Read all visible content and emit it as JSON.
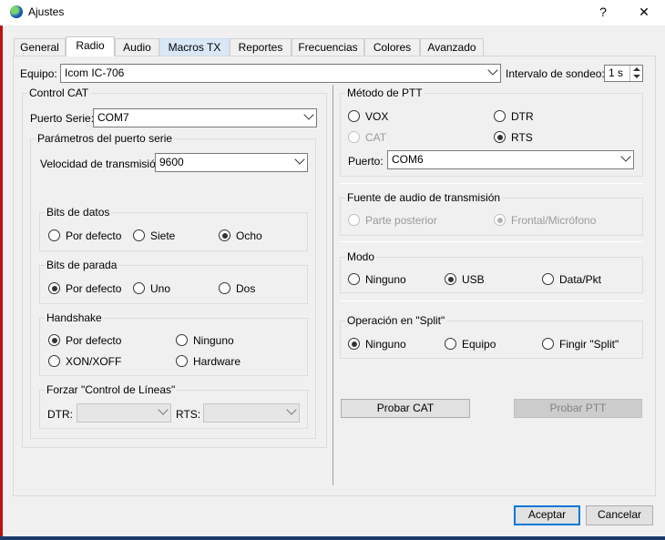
{
  "window": {
    "title": "Ajustes",
    "help_label": "?",
    "close_label": "✕"
  },
  "tabs": [
    {
      "label": "General"
    },
    {
      "label": "Radio"
    },
    {
      "label": "Audio"
    },
    {
      "label": "Macros  TX"
    },
    {
      "label": "Reportes"
    },
    {
      "label": "Frecuencias"
    },
    {
      "label": "Colores"
    },
    {
      "label": "Avanzado"
    }
  ],
  "active_tab": "Radio",
  "rig": {
    "label": "Equipo:",
    "value": "Icom IC-706",
    "poll_label": "Intervalo de sondeo:",
    "poll_value": "1 s"
  },
  "cat": {
    "title": "Control CAT",
    "port_label": "Puerto Serie:",
    "port_value": "COM7",
    "params_title": "Parámetros del puerto serie",
    "baud_label": "Velocidad de transmisión:",
    "baud_value": "9600",
    "data_bits": {
      "title": "Bits de datos",
      "options": [
        "Por defecto",
        "Siete",
        "Ocho"
      ],
      "selected": "Ocho"
    },
    "stop_bits": {
      "title": "Bits de parada",
      "options": [
        "Por defecto",
        "Uno",
        "Dos"
      ],
      "selected": "Por defecto"
    },
    "handshake": {
      "title": "Handshake",
      "options": [
        "Por defecto",
        "Ninguno",
        "XON/XOFF",
        "Hardware"
      ],
      "selected": "Por defecto"
    },
    "force_lines": {
      "title": "Forzar \"Control de Líneas\"",
      "dtr_label": "DTR:",
      "dtr_value": "",
      "rts_label": "RTS:",
      "rts_value": ""
    }
  },
  "ptt": {
    "title": "Método de PTT",
    "options": [
      "VOX",
      "DTR",
      "CAT",
      "RTS"
    ],
    "selected": "RTS",
    "port_label": "Puerto:",
    "port_value": "COM6"
  },
  "audio_source": {
    "title": "Fuente de audio de transmisión",
    "options": [
      "Parte posterior",
      "Frontal/Micrófono"
    ],
    "selected": "Frontal/Micrófono"
  },
  "mode": {
    "title": "Modo",
    "options": [
      "Ninguno",
      "USB",
      "Data/Pkt"
    ],
    "selected": "USB"
  },
  "split": {
    "title": "Operación en \"Split\"",
    "options": [
      "Ninguno",
      "Equipo",
      "Fingir \"Split\""
    ],
    "selected": "Ninguno"
  },
  "actions": {
    "test_cat": "Probar CAT",
    "test_ptt": "Probar PTT",
    "ok": "Aceptar",
    "cancel": "Cancelar"
  },
  "colors": {
    "accent": "#0078d7",
    "tab_highlight": "#d9e8f7"
  }
}
